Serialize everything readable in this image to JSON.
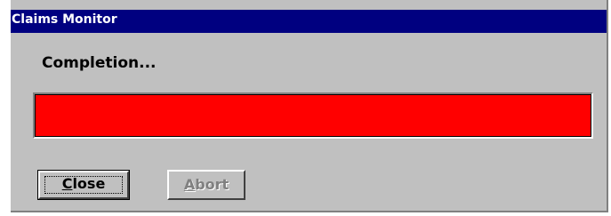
{
  "window": {
    "title": "Claims Monitor"
  },
  "status": {
    "label": "Completion..."
  },
  "progress": {
    "fraction": 1.0,
    "fill_color": "#ff0000"
  },
  "buttons": {
    "close": {
      "hotkey": "C",
      "rest": "lose",
      "enabled": true
    },
    "abort": {
      "hotkey": "A",
      "rest": "bort",
      "enabled": false
    }
  },
  "colors": {
    "titlebar": "#000080",
    "face": "#c0c0c0"
  }
}
